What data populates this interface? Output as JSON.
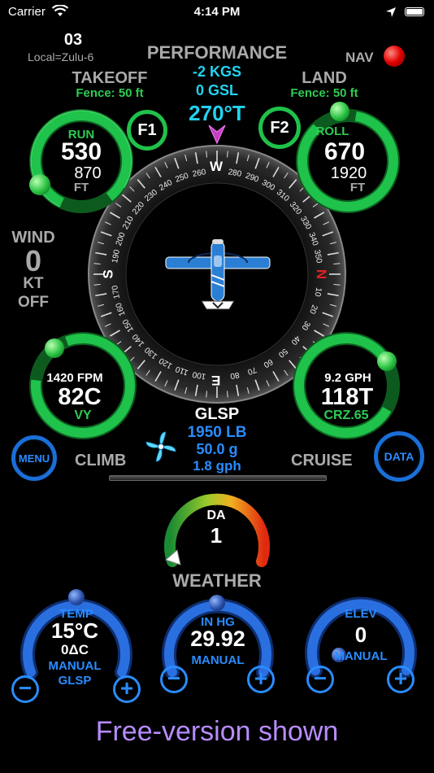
{
  "status_bar": {
    "carrier": "Carrier",
    "time": "4:14 PM"
  },
  "header": {
    "day": "03",
    "timezone": "Local=Zulu-6",
    "title": "PERFORMANCE",
    "kgs": "-2 KGS",
    "gsl": "0 GSL",
    "heading": "270°T",
    "nav_label": "NAV"
  },
  "takeoff": {
    "label": "TAKEOFF",
    "fence": "Fence: 50 ft",
    "gauge_label": "RUN",
    "value": "530",
    "sub": "870",
    "unit": "FT",
    "button": "F1"
  },
  "land": {
    "label": "LAND",
    "fence": "Fence: 50 ft",
    "gauge_label": "ROLL",
    "value": "670",
    "sub": "1920",
    "unit": "FT",
    "button": "F2"
  },
  "wind": {
    "label": "WIND",
    "value": "0",
    "unit": "KT",
    "status": "OFF"
  },
  "compass": {
    "cardinals": {
      "w": "W",
      "n": "N",
      "s": "S",
      "e": "E"
    },
    "numbers": [
      "280",
      "290",
      "300",
      "310",
      "320",
      "330",
      "340",
      "350",
      "10",
      "20",
      "30",
      "40",
      "50",
      "60",
      "70",
      "80",
      "100",
      "110",
      "120",
      "130",
      "140",
      "150",
      "160",
      "170",
      "190",
      "200",
      "210",
      "220",
      "230",
      "240",
      "250",
      "260"
    ]
  },
  "climb": {
    "rate": "1420 FPM",
    "value": "82C",
    "mode": "VY",
    "label": "CLIMB"
  },
  "cruise": {
    "rate": "9.2 GPH",
    "value": "118T",
    "mode": "CRZ.65",
    "label": "CRUISE"
  },
  "fuel": {
    "type": "GLSP",
    "weight": "1950 LB",
    "gallons": "50.0 g",
    "burn": "1.8 gph"
  },
  "menu_button": "MENU",
  "data_button": "DATA",
  "density_altitude": {
    "label": "DA",
    "value": "1"
  },
  "weather": {
    "label": "WEATHER"
  },
  "temp": {
    "label": "TEMP",
    "value": "15°C",
    "delta": "0ΔC",
    "mode": "MANUAL",
    "source": "GLSP"
  },
  "pressure": {
    "label": "IN HG",
    "value": "29.92",
    "mode": "MANUAL"
  },
  "elevation": {
    "label": "ELEV",
    "value": "0",
    "mode": "MANUAL"
  },
  "controls": {
    "minus": "−",
    "plus": "+"
  },
  "footer": "Free-version shown",
  "colors": {
    "green_ring": "#1fc24a",
    "blue_ring": "#2a8cff",
    "cyan": "#22d3f0",
    "nav_light": "#e00000",
    "footer": "#b78cff"
  }
}
